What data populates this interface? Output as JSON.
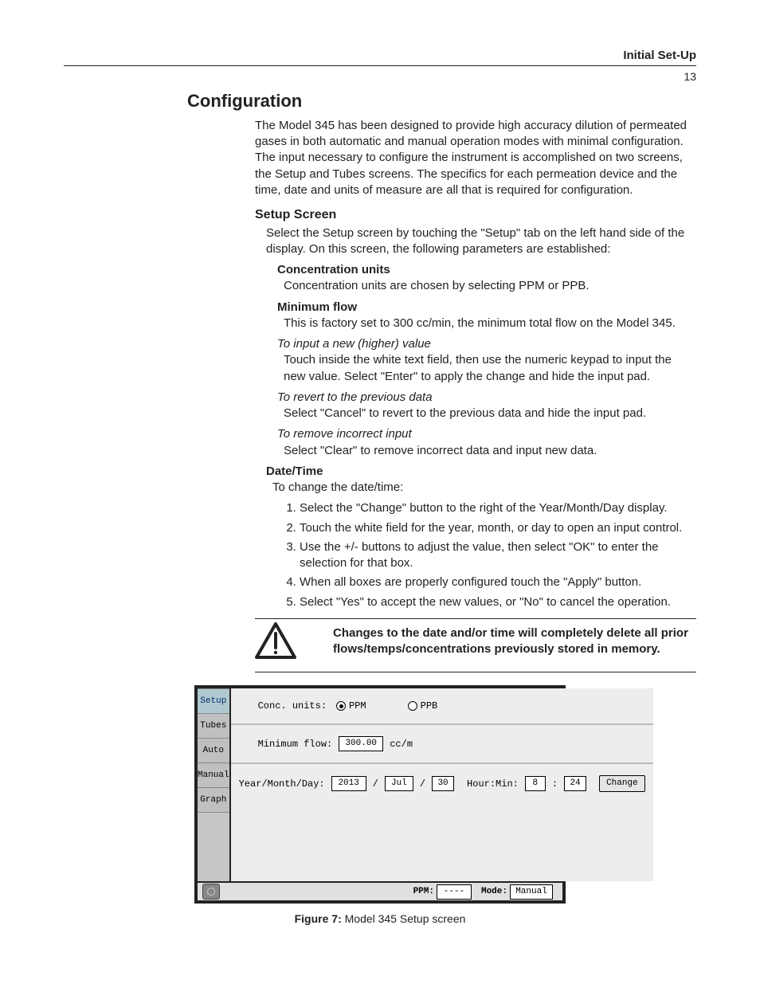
{
  "header": {
    "section_label": "Initial Set-Up",
    "page_number": "13"
  },
  "title": "Configuration",
  "intro": "The Model 345 has been designed to provide high accuracy dilution of permeated gases in both automatic and manual operation modes with minimal configuration. The input necessary to configure the instrument is accomplished on two screens, the Setup and Tubes screens.  The specifics for each permeation device and the time, date and units of measure are all that is required for configuration.",
  "setup_screen": {
    "heading": "Setup Screen",
    "lead": "Select the Setup screen by touching the \"Setup\" tab on the left hand side of the display.  On this screen, the following parameters are established:",
    "conc_units": {
      "title": "Concentration units",
      "body": "Concentration units are chosen by selecting PPM or PPB."
    },
    "min_flow": {
      "title": "Minimum flow",
      "body": "This is  factory set to 300 cc/min, the minimum total flow on the Model 345.",
      "input_new_head": "To input a new (higher) value",
      "input_new_body": "Touch inside the white text field, then use the numeric keypad to input the new value.  Select \"Enter\" to apply the change and hide the input pad.",
      "revert_head": "To revert to the previous data",
      "revert_body": "Select \"Cancel\" to revert to the previous data and hide the input pad.",
      "remove_head": "To remove incorrect input",
      "remove_body": "Select \"Clear\" to remove incorrect data and input new data."
    },
    "date_time": {
      "title": "Date/Time",
      "lead": "To change the date/time:",
      "steps": [
        "Select the \"Change\" button to the right of the Year/Month/Day display.",
        "Touch the white field for the year, month, or day to open an input control.",
        "Use the +/- buttons to adjust the value, then select \"OK\" to enter the selection for that box.",
        "When all boxes are properly configured touch the \"Apply\" button.",
        " Select \"Yes\" to accept the new values, or \"No\" to cancel the operation."
      ]
    }
  },
  "warning": "Changes to the date and/or time will completely delete all prior flows/temps/concentrations previously stored in memory.",
  "device": {
    "tabs": [
      "Setup",
      "Tubes",
      "Auto",
      "Manual",
      "Graph"
    ],
    "active_tab": "Setup",
    "conc_units_label": "Conc. units:",
    "radio_ppm": "PPM",
    "radio_ppb": "PPB",
    "selected_unit": "PPM",
    "min_flow_label": "Minimum flow:",
    "min_flow_value": "300.00",
    "min_flow_unit": "cc/m",
    "date_label": "Year/Month/Day:",
    "year": "2013",
    "month": "Jul",
    "day": "30",
    "time_label": "Hour:Min:",
    "hour": "8",
    "minute": "24",
    "change_btn": "Change",
    "status_ppm_label": "PPM:",
    "status_ppm_value": "----",
    "status_mode_label": "Mode:",
    "status_mode_value": "Manual"
  },
  "figure": {
    "label": "Figure 7:",
    "caption": " Model 345 Setup screen"
  }
}
